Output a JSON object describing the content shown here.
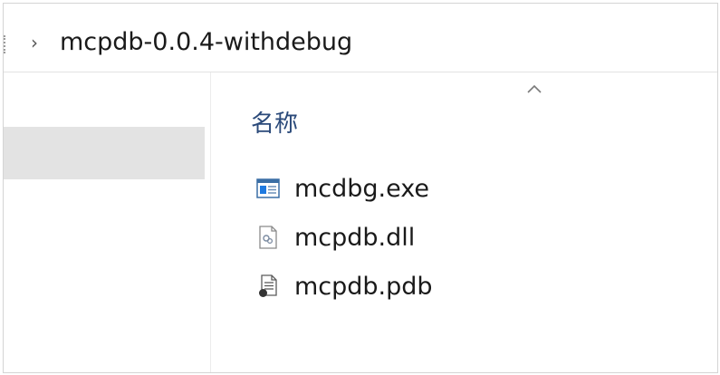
{
  "breadcrumb": {
    "current_folder": "mcpdb-0.0.4-withdebug"
  },
  "file_list": {
    "column_header": "名称",
    "files": [
      {
        "name": "mcdbg.exe",
        "icon": "exe-file-icon"
      },
      {
        "name": "mcpdb.dll",
        "icon": "dll-file-icon"
      },
      {
        "name": "mcpdb.pdb",
        "icon": "pdb-file-icon"
      }
    ]
  }
}
